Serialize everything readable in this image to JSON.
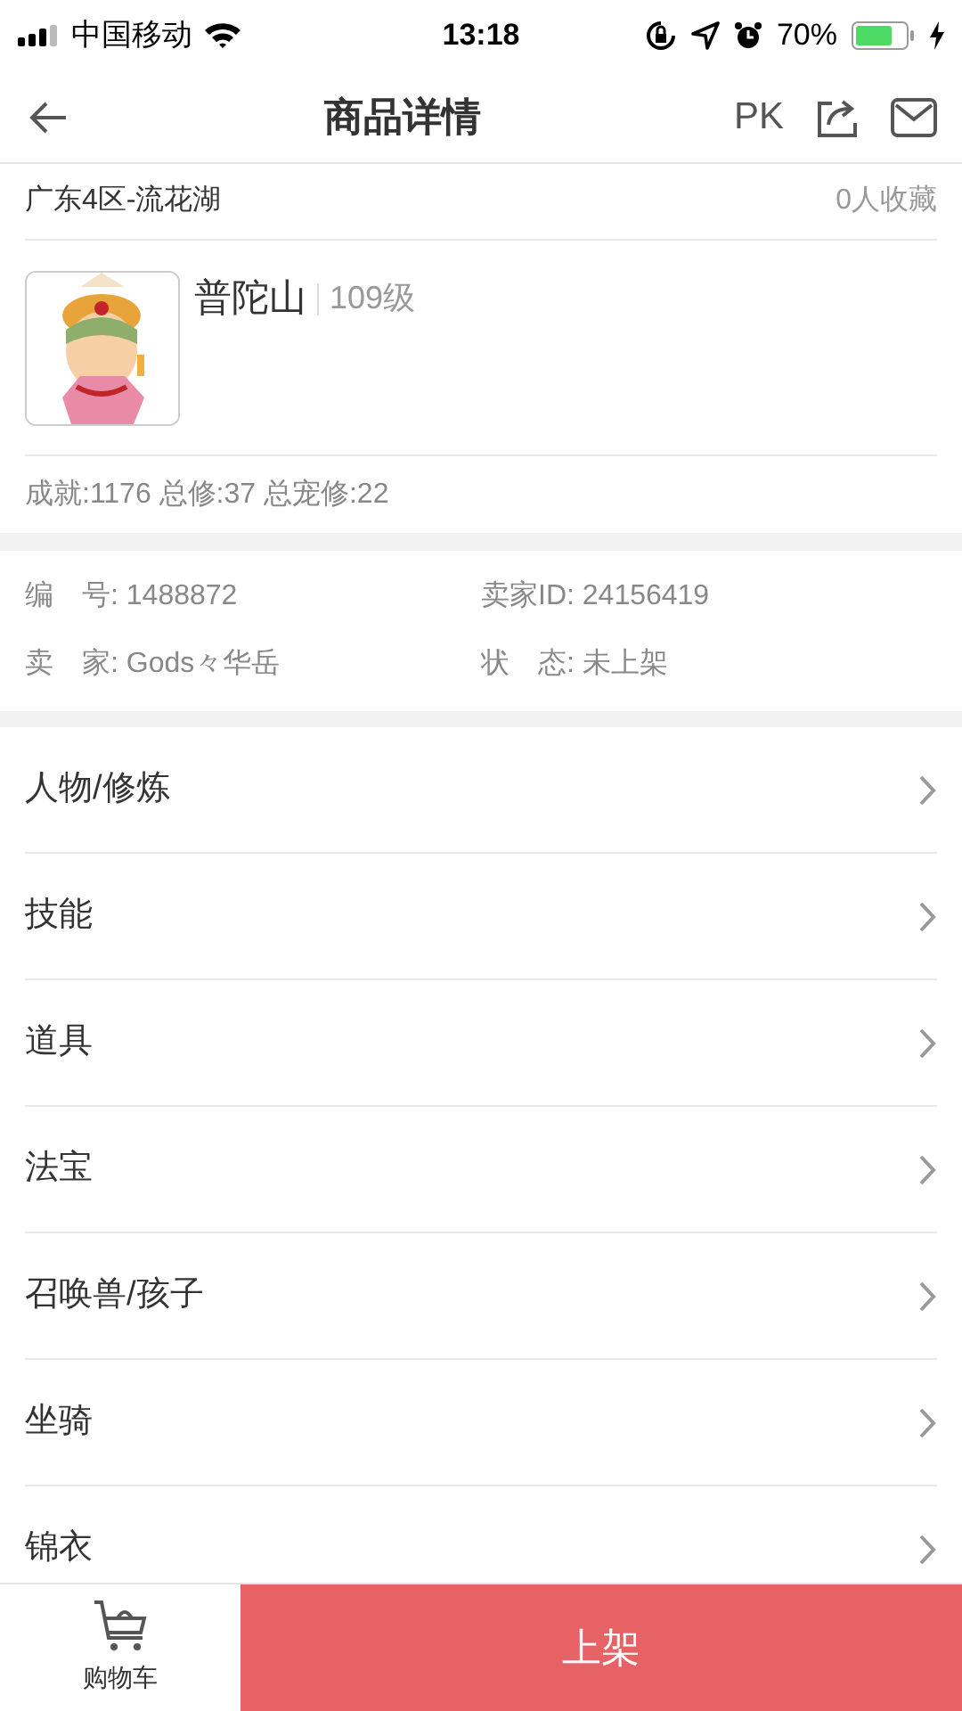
{
  "status_bar": {
    "carrier": "中国移动",
    "time": "13:18",
    "battery": "70%"
  },
  "nav": {
    "title": "商品详情",
    "pk": "PK"
  },
  "location": {
    "server": "广东4区-流花湖",
    "favorites": "0人收藏"
  },
  "character": {
    "school": "普陀山",
    "level": "109级"
  },
  "stats": "成就:1176 总修:37 总宠修:22",
  "info": [
    {
      "label": "编　号:",
      "value": "1488872"
    },
    {
      "label": "卖家ID:",
      "value": "24156419"
    },
    {
      "label": "卖　家:",
      "value": "Gods々华岳"
    },
    {
      "label": "状　态:",
      "value": "未上架"
    }
  ],
  "sections": [
    "人物/修炼",
    "技能",
    "道具",
    "法宝",
    "召唤兽/孩子",
    "坐骑",
    "锦衣"
  ],
  "bottom_bar": {
    "cart": "购物车",
    "action": "上架"
  }
}
